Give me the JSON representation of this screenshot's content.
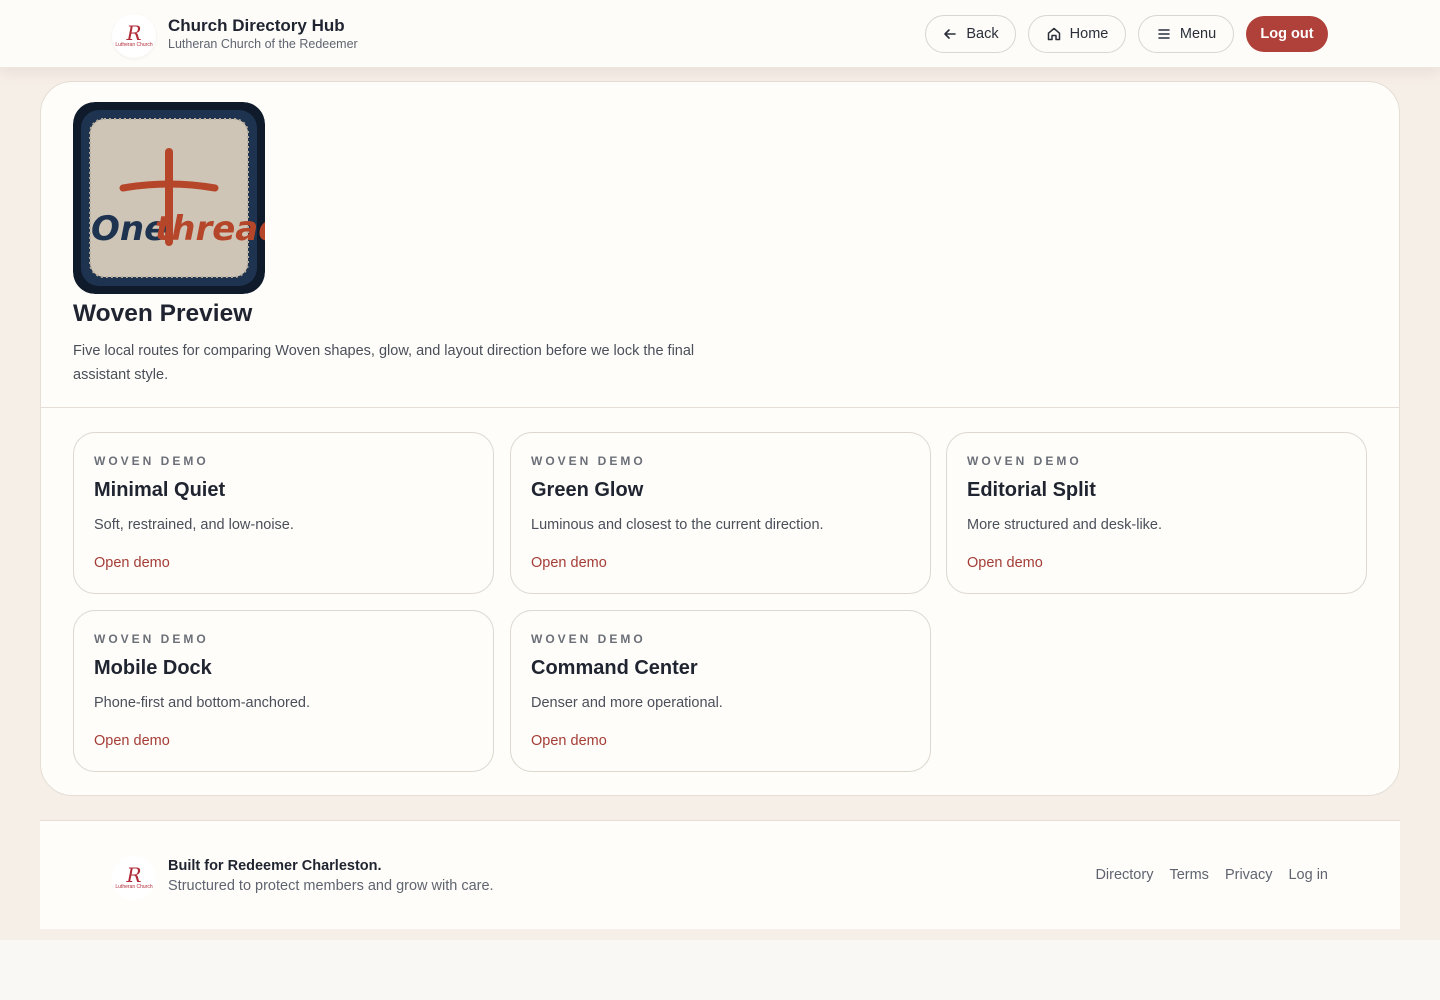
{
  "header": {
    "logo_text": "R",
    "logo_caption": "Lutheran Church",
    "title": "Church Directory Hub",
    "subtitle": "Lutheran Church of the Redeemer",
    "nav": {
      "back": "Back",
      "home": "Home",
      "menu": "Menu",
      "logout": "Log out"
    }
  },
  "hero": {
    "image_text_left": "One",
    "image_text_right": "thread",
    "title": "Woven Preview",
    "description": "Five local routes for comparing Woven shapes, glow, and layout direction before we lock the final assistant style."
  },
  "demos": [
    {
      "eyebrow": "WOVEN DEMO",
      "title": "Minimal Quiet",
      "description": "Soft, restrained, and low-noise.",
      "link": "Open demo"
    },
    {
      "eyebrow": "WOVEN DEMO",
      "title": "Green Glow",
      "description": "Luminous and closest to the current direction.",
      "link": "Open demo"
    },
    {
      "eyebrow": "WOVEN DEMO",
      "title": "Editorial Split",
      "description": "More structured and desk-like.",
      "link": "Open demo"
    },
    {
      "eyebrow": "WOVEN DEMO",
      "title": "Mobile Dock",
      "description": "Phone-first and bottom-anchored.",
      "link": "Open demo"
    },
    {
      "eyebrow": "WOVEN DEMO",
      "title": "Command Center",
      "description": "Denser and more operational.",
      "link": "Open demo"
    }
  ],
  "footer": {
    "title": "Built for Redeemer Charleston.",
    "subtitle": "Structured to protect members and grow with care.",
    "links": [
      "Directory",
      "Terms",
      "Privacy",
      "Log in"
    ]
  },
  "colors": {
    "accent": "#b0413a",
    "link": "#a53d37",
    "page_background": "#f6efe8",
    "card_background": "#fefdf9"
  }
}
